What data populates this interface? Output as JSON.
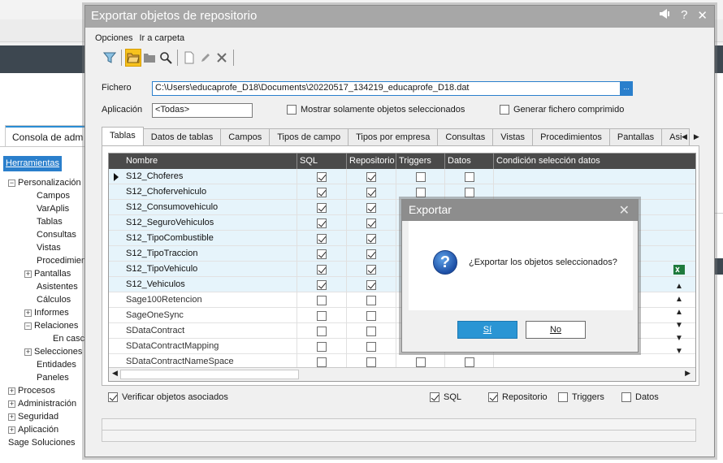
{
  "background": {
    "console_tab": "Consola de adm",
    "herramientas": "Herramientas",
    "tree": [
      {
        "label": "Personalización",
        "toggle": "−"
      },
      {
        "label": "Campos"
      },
      {
        "label": "VarAplis"
      },
      {
        "label": "Tablas"
      },
      {
        "label": "Consultas"
      },
      {
        "label": "Vistas"
      },
      {
        "label": "Procedimient"
      },
      {
        "label": "Pantallas",
        "toggle": "+"
      },
      {
        "label": "Asistentes"
      },
      {
        "label": "Cálculos"
      },
      {
        "label": "Informes",
        "toggle": "+"
      },
      {
        "label": "Relaciones",
        "toggle": "−"
      },
      {
        "label": "En casca"
      },
      {
        "label": "Selecciones",
        "toggle": "+"
      },
      {
        "label": "Entidades"
      },
      {
        "label": "Paneles"
      },
      {
        "label": "Procesos",
        "toggle": "+"
      },
      {
        "label": "Administración",
        "toggle": "+"
      },
      {
        "label": "Seguridad",
        "toggle": "+"
      },
      {
        "label": "Aplicación",
        "toggle": "+"
      },
      {
        "label": "Sage Soluciones"
      }
    ]
  },
  "window": {
    "title": "Exportar objetos de repositorio",
    "title_icons": [
      "megaphone-icon",
      "?",
      "✕"
    ],
    "menu": [
      "Opciones",
      "Ir a carpeta"
    ],
    "fichero_label": "Fichero",
    "fichero_value": "C:\\Users\\educaprofe_D18\\Documents\\20220517_134219_educaprofe_D18.dat",
    "fichero_button": "...",
    "aplicacion_label": "Aplicación",
    "aplicacion_value": "<Todas>",
    "mostrar_label": "Mostrar solamente objetos seleccionados",
    "generar_label": "Generar fichero comprimido",
    "tabs": [
      "Tablas",
      "Datos de tablas",
      "Campos",
      "Tipos de campo",
      "Tipos por empresa",
      "Consultas",
      "Vistas",
      "Procedimientos",
      "Pantallas",
      "Asi"
    ],
    "grid": {
      "columns": [
        "Nombre",
        "SQL",
        "Repositorio",
        "Triggers",
        "Datos",
        "Condición selección datos"
      ],
      "rows": [
        {
          "name": "S12_Choferes",
          "sql": true,
          "repo": true,
          "trig": false,
          "datos": false,
          "sel": true
        },
        {
          "name": "S12_Chofervehiculo",
          "sql": true,
          "repo": true,
          "trig": false,
          "datos": false,
          "sel": true
        },
        {
          "name": "S12_Consumovehiculo",
          "sql": true,
          "repo": true,
          "trig": false,
          "datos": false,
          "sel": true
        },
        {
          "name": "S12_SeguroVehiculos",
          "sql": true,
          "repo": true,
          "trig": false,
          "datos": false,
          "sel": true
        },
        {
          "name": "S12_TipoCombustible",
          "sql": true,
          "repo": true,
          "trig": false,
          "datos": false,
          "sel": true
        },
        {
          "name": "S12_TipoTraccion",
          "sql": true,
          "repo": true,
          "trig": false,
          "datos": false,
          "sel": true
        },
        {
          "name": "S12_TipoVehiculo",
          "sql": true,
          "repo": true,
          "trig": false,
          "datos": false,
          "sel": true
        },
        {
          "name": "S12_Vehiculos",
          "sql": true,
          "repo": true,
          "trig": false,
          "datos": false,
          "sel": true
        },
        {
          "name": "Sage100Retencion",
          "sql": false,
          "repo": false,
          "trig": false,
          "datos": false,
          "sel": false
        },
        {
          "name": "SageOneSync",
          "sql": false,
          "repo": false,
          "trig": false,
          "datos": false,
          "sel": false
        },
        {
          "name": "SDataContract",
          "sql": false,
          "repo": false,
          "trig": false,
          "datos": false,
          "sel": false
        },
        {
          "name": "SDataContractMapping",
          "sql": false,
          "repo": false,
          "trig": false,
          "datos": false,
          "sel": false
        },
        {
          "name": "SDataContractNameSpace",
          "sql": false,
          "repo": false,
          "trig": false,
          "datos": false,
          "sel": false
        }
      ]
    },
    "verificar_label": "Verificar objetos asociados",
    "bottom_checks": [
      {
        "label": "SQL",
        "checked": true
      },
      {
        "label": "Repositorio",
        "checked": true
      },
      {
        "label": "Triggers",
        "checked": false
      },
      {
        "label": "Datos",
        "checked": false
      }
    ]
  },
  "confirm": {
    "title": "Exportar",
    "close": "✕",
    "message": "¿Exportar los objetos seleccionados?",
    "yes": "Sí",
    "no": "No"
  },
  "colors": {
    "accent": "#2a95d4",
    "header": "#4a4a4a",
    "selected_row": "#e6f4fb",
    "toolbar_active": "#f7c21d"
  }
}
